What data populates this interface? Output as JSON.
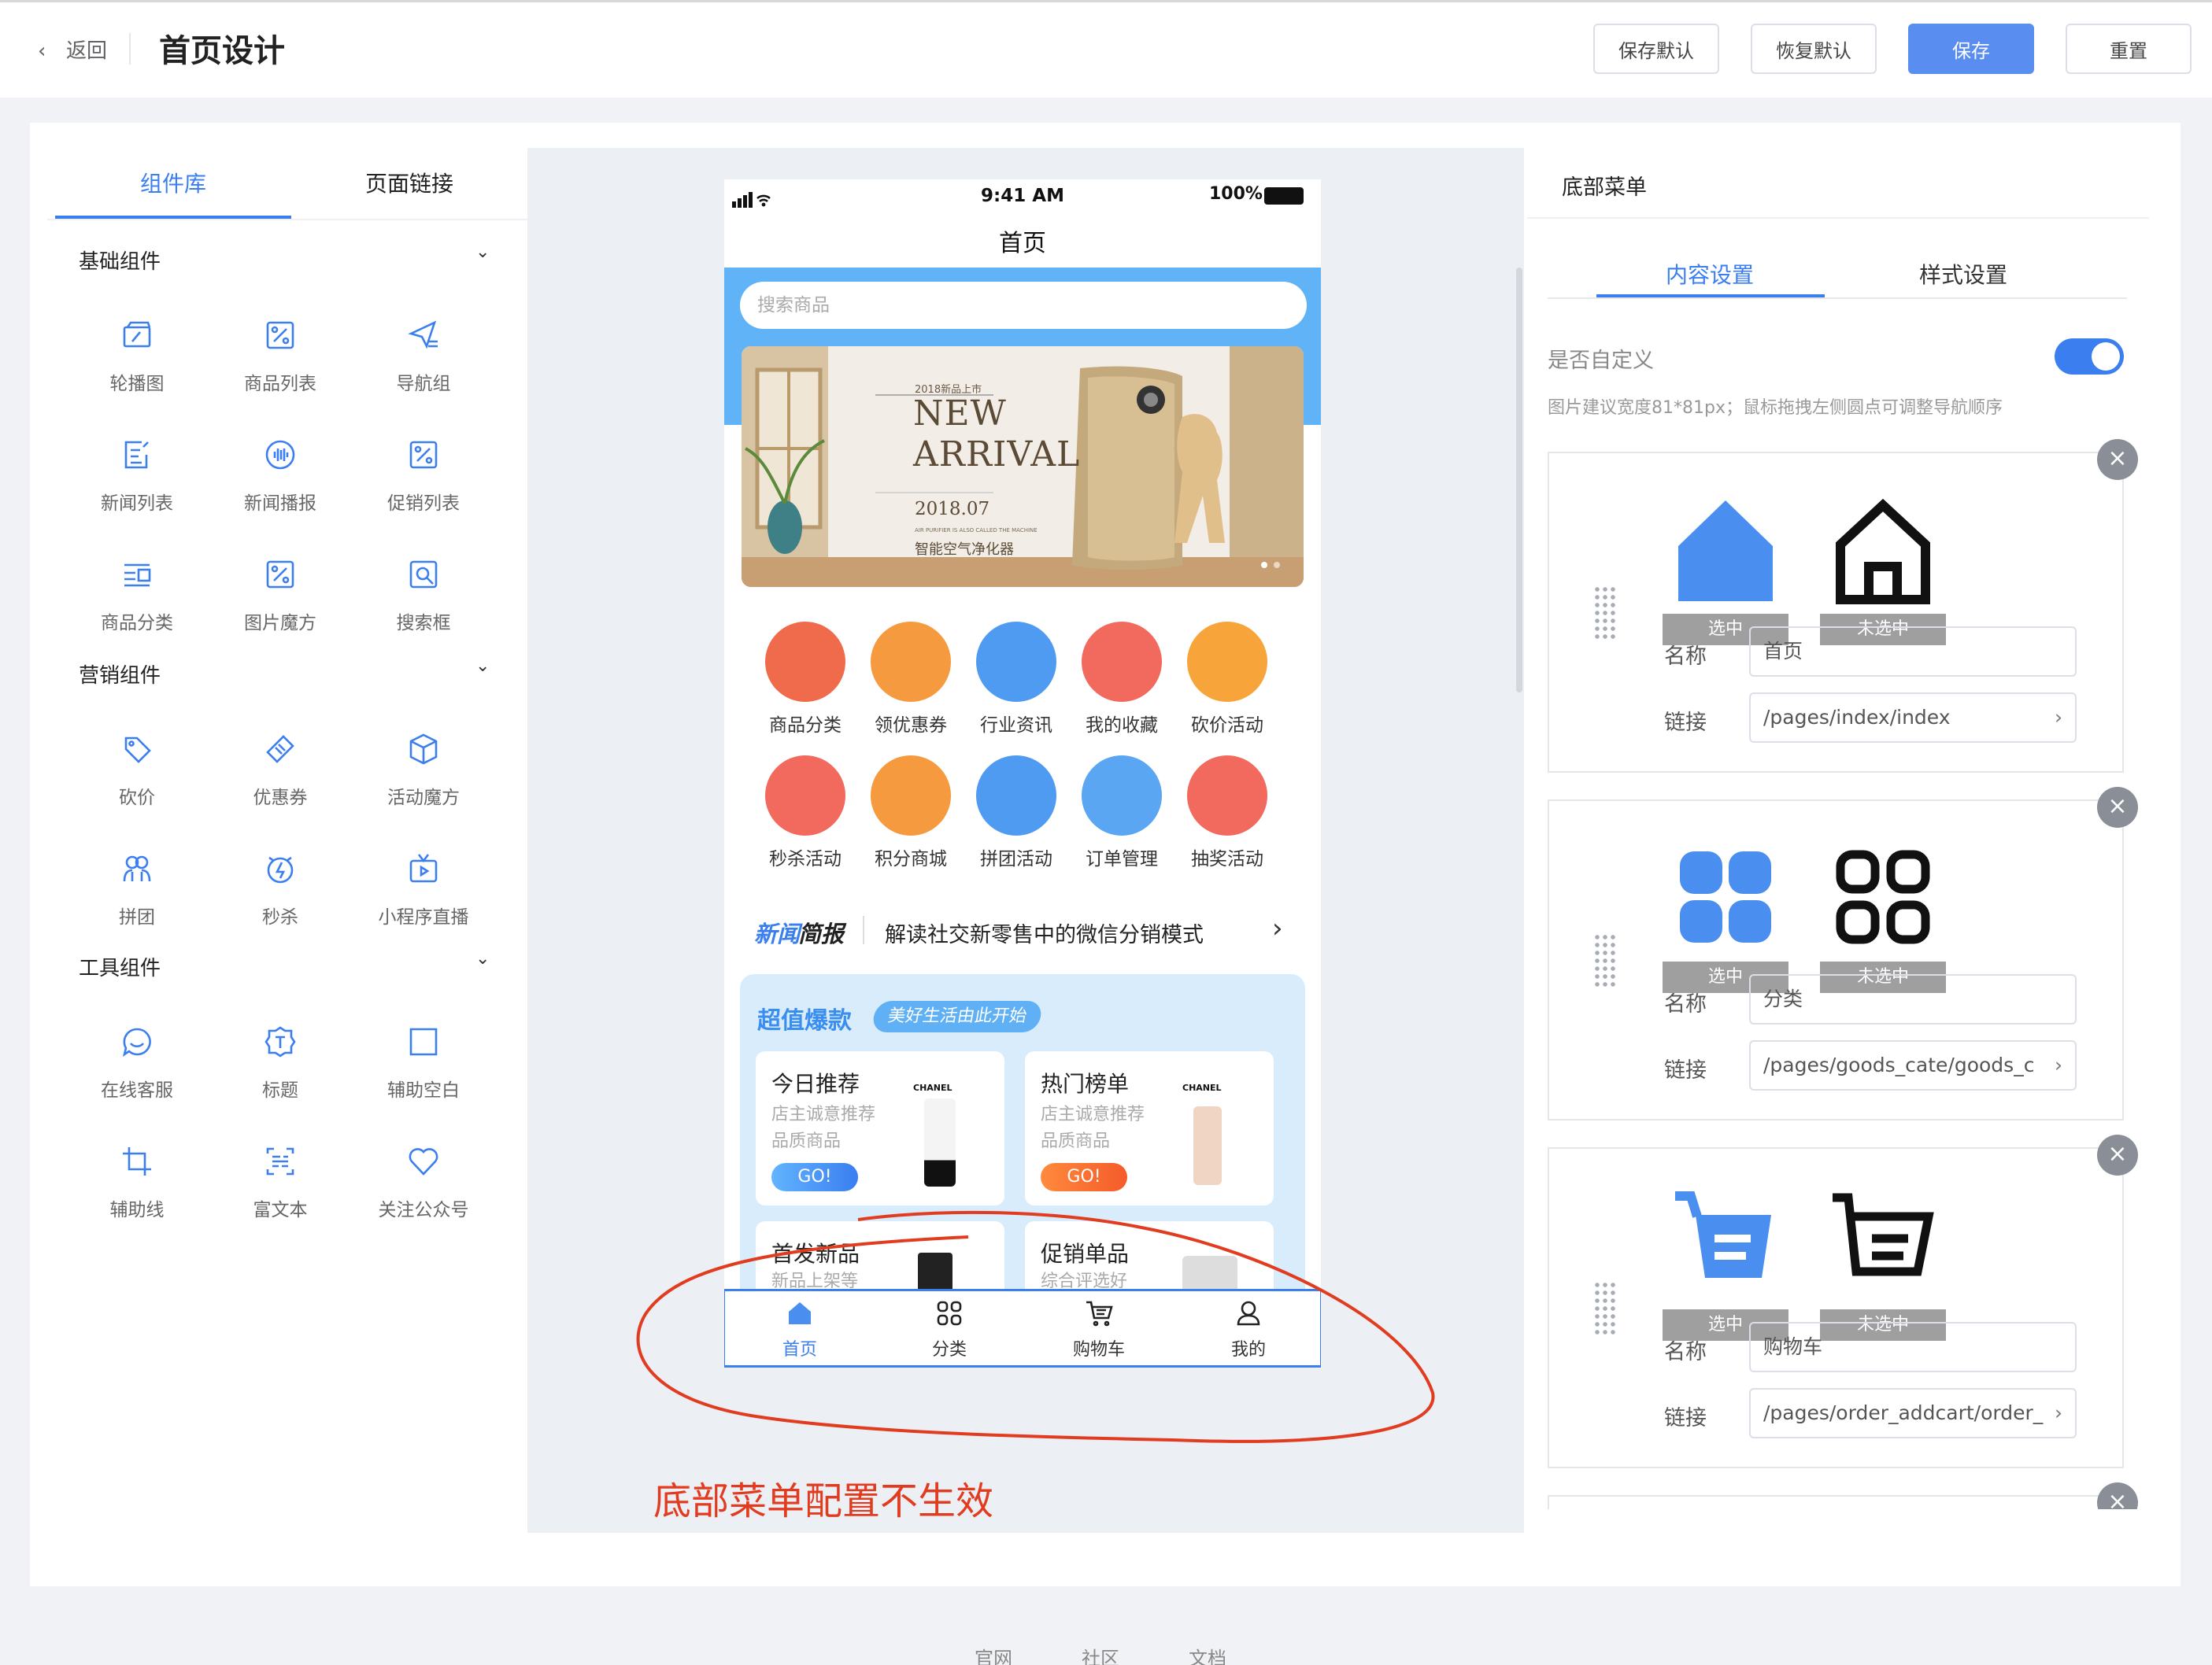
{
  "header": {
    "back_label": "返回",
    "title": "首页设计",
    "buttons": [
      "保存默认",
      "恢复默认",
      "保存",
      "重置"
    ]
  },
  "left_panel": {
    "tabs": [
      "组件库",
      "页面链接"
    ],
    "sections": [
      {
        "title": "基础组件",
        "items": [
          {
            "label": "轮播图",
            "icon": "carousel-icon"
          },
          {
            "label": "商品列表",
            "icon": "percent-tag-icon"
          },
          {
            "label": "导航组",
            "icon": "send-nav-icon"
          },
          {
            "label": "新闻列表",
            "icon": "edit-doc-icon"
          },
          {
            "label": "新闻播报",
            "icon": "broadcast-icon"
          },
          {
            "label": "促销列表",
            "icon": "percent-tag-icon"
          },
          {
            "label": "商品分类",
            "icon": "category-list-icon"
          },
          {
            "label": "图片魔方",
            "icon": "percent-tag-icon"
          },
          {
            "label": "搜索框",
            "icon": "search-box-icon"
          }
        ]
      },
      {
        "title": "营销组件",
        "items": [
          {
            "label": "砍价",
            "icon": "tag-icon"
          },
          {
            "label": "优惠券",
            "icon": "coupon-icon"
          },
          {
            "label": "活动魔方",
            "icon": "cube-icon"
          },
          {
            "label": "拼团",
            "icon": "group-icon"
          },
          {
            "label": "秒杀",
            "icon": "flash-timer-icon"
          },
          {
            "label": "小程序直播",
            "icon": "live-tv-icon"
          }
        ]
      },
      {
        "title": "工具组件",
        "items": [
          {
            "label": "在线客服",
            "icon": "chat-icon"
          },
          {
            "label": "标题",
            "icon": "title-icon"
          },
          {
            "label": "辅助空白",
            "icon": "blank-icon"
          },
          {
            "label": "辅助线",
            "icon": "crop-line-icon"
          },
          {
            "label": "富文本",
            "icon": "rich-text-icon"
          },
          {
            "label": "关注公众号",
            "icon": "heart-icon"
          }
        ]
      }
    ]
  },
  "phone": {
    "time": "9:41 AM",
    "battery": "100%",
    "title": "首页",
    "search_placeholder": "搜索商品",
    "banner": {
      "small": "2018新品上市",
      "line1": "NEW",
      "line2": "ARRIVAL",
      "date": "2018.07",
      "tiny": "AIR PURIFIER IS ALSO CALLED THE MACHINE",
      "product": "智能空气净化器"
    },
    "categories": [
      {
        "label": "商品分类",
        "color": "#f06b4b"
      },
      {
        "label": "领优惠券",
        "color": "#f59a3e"
      },
      {
        "label": "行业资讯",
        "color": "#4f9bf1"
      },
      {
        "label": "我的收藏",
        "color": "#f26a5d"
      },
      {
        "label": "砍价活动",
        "color": "#f7a53a"
      },
      {
        "label": "秒杀活动",
        "color": "#f26a5d"
      },
      {
        "label": "积分商城",
        "color": "#f59a3e"
      },
      {
        "label": "拼团活动",
        "color": "#4f9bf1"
      },
      {
        "label": "订单管理",
        "color": "#5aa6f2"
      },
      {
        "label": "抽奖活动",
        "color": "#f26a5d"
      }
    ],
    "news": {
      "tag_a": "新闻",
      "tag_b": "简报",
      "text": "解读社交新零售中的微信分销模式"
    },
    "promo": {
      "title": "超值爆款",
      "pill": "美好生活由此开始",
      "cards": [
        {
          "title": "今日推荐",
          "sub": "店主诚意推荐 品质商品",
          "go": "GO!",
          "brand": "CHANEL"
        },
        {
          "title": "热门榜单",
          "sub": "店主诚意推荐 品质商品",
          "go": "GO!",
          "brand": "CHANEL"
        },
        {
          "title": "首发新品",
          "sub": "新品上架等"
        },
        {
          "title": "促销单品",
          "sub": "综合评选好"
        }
      ]
    },
    "tabbar": [
      {
        "label": "首页",
        "icon": "home-icon",
        "active": true
      },
      {
        "label": "分类",
        "icon": "grid-icon",
        "active": false
      },
      {
        "label": "购物车",
        "icon": "cart-icon",
        "active": false
      },
      {
        "label": "我的",
        "icon": "user-icon",
        "active": false
      }
    ]
  },
  "annotation": "底部菜单配置不生效",
  "right_panel": {
    "title": "底部菜单",
    "tabs": [
      "内容设置",
      "样式设置"
    ],
    "custom_label": "是否自定义",
    "custom_enabled": true,
    "hint": "图片建议宽度81*81px；鼠标拖拽左侧圆点可调整导航顺序",
    "selected_label": "选中",
    "unselected_label": "未选中",
    "name_label": "名称",
    "link_label": "链接",
    "nav_items": [
      {
        "name": "首页",
        "link": "/pages/index/index",
        "icon": "home-icon"
      },
      {
        "name": "分类",
        "link": "/pages/goods_cate/goods_c",
        "icon": "grid-icon"
      },
      {
        "name": "购物车",
        "link": "/pages/order_addcart/order_",
        "icon": "cart-icon"
      }
    ]
  },
  "footer": {
    "links": [
      "官网",
      "社区",
      "文档"
    ]
  },
  "colors": {
    "accent": "#3a7ef0",
    "primary_button": "#5a8df0",
    "annotation": "#e23c20"
  }
}
